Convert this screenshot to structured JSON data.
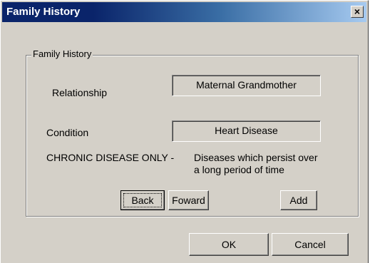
{
  "window": {
    "title": "Family History",
    "close_glyph": "×"
  },
  "group": {
    "legend": "Family History"
  },
  "relationship": {
    "label": "Relationship",
    "value": "Maternal Grandmother"
  },
  "condition": {
    "label": "Condition",
    "value": "Heart Disease"
  },
  "chronic": {
    "label": "CHRONIC DISEASE ONLY -",
    "description_line1": "Diseases which persist over",
    "description_line2": "a long period of time"
  },
  "buttons": {
    "back": "Back",
    "forward": "Foward",
    "add": "Add",
    "ok": "OK",
    "cancel": "Cancel"
  },
  "icons": {
    "close": "close-icon"
  },
  "colors": {
    "title_bar_start": "#0a246a",
    "title_bar_end": "#a6caf0",
    "window_bg": "#d4d0c8"
  }
}
